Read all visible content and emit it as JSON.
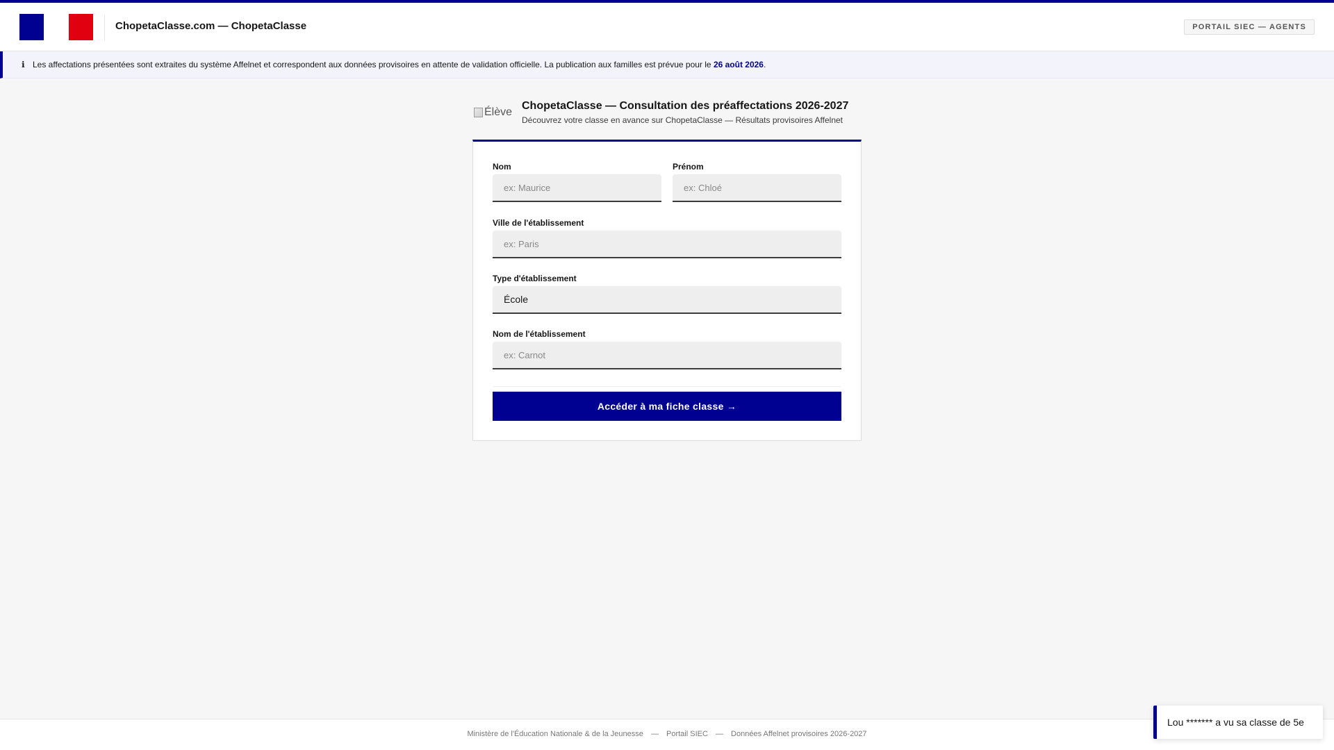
{
  "header": {
    "title": "ChopetaClasse.com — ChopetaClasse",
    "portal_badge": "PORTAIL SIEC — AGENTS",
    "flag_colors": [
      "#000091",
      "#ffffff",
      "#e1000f"
    ]
  },
  "notice": {
    "icon": "info-icon",
    "icon_glyph": "ℹ",
    "text": "Les affectations présentées sont extraites du système Affelnet et correspondent aux données provisoires en attente de validation officielle. La publication aux familles est prévue pour le ",
    "date": "26 août 2026",
    "suffix": "."
  },
  "form": {
    "image_alt": "Élève",
    "title": "ChopetaClasse — Consultation des préaffectations 2026-2027",
    "subtitle": "Découvrez votre classe en avance sur ChopetaClasse — Résultats provisoires Affelnet",
    "fields": {
      "nom": {
        "label": "Nom",
        "placeholder": "ex: Maurice",
        "value": ""
      },
      "prenom": {
        "label": "Prénom",
        "placeholder": "ex: Chloé",
        "value": ""
      },
      "ville": {
        "label": "Ville de l'établissement",
        "placeholder": "ex: Paris",
        "value": ""
      },
      "type": {
        "label": "Type d'établissement",
        "selected": "École"
      },
      "etablissement": {
        "label": "Nom de l'établissement",
        "placeholder": "ex: Carnot",
        "value": ""
      }
    },
    "submit_label": "Accéder à ma fiche classe →"
  },
  "footer": {
    "items": [
      "Ministère de l'Éducation Nationale & de la Jeunesse",
      "Portail SIEC",
      "Données Affelnet provisoires 2026-2027"
    ],
    "separator": "—"
  },
  "toast": {
    "text": "Lou ******* a vu sa classe de 5e"
  },
  "colors": {
    "accent": "#000091",
    "red": "#e1000f",
    "background": "#f6f6f6"
  }
}
